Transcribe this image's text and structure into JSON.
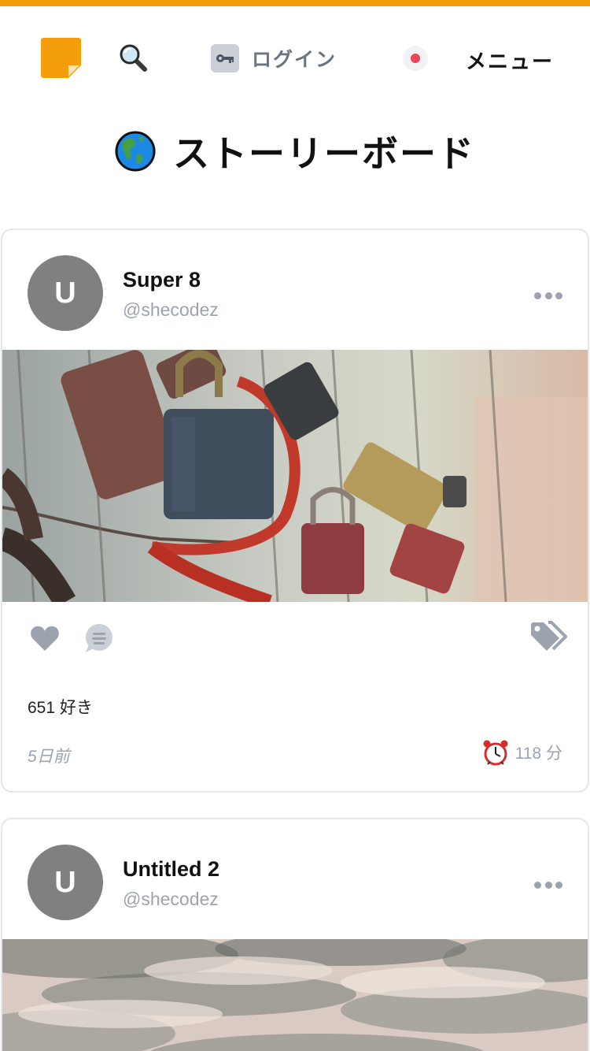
{
  "colors": {
    "accent": "#f59e0b",
    "status_dot": "#ef4458",
    "muted": "#9ca3af"
  },
  "nav": {
    "logo_icon": "sticky-note-icon",
    "search_icon": "magnifier-icon",
    "login_icon": "key-icon",
    "login_label": "ログイン",
    "status_icon": "red-dot-icon",
    "menu_label": "メニュー"
  },
  "page": {
    "title_icon": "globe-americas-icon",
    "title": "ストーリーボード"
  },
  "posts": [
    {
      "avatar_letter": "U",
      "title": "Super 8",
      "handle": "@shecodez",
      "image": "padlocks-on-fence-photo",
      "likes_text": "651 好き",
      "time_ago": "5日前",
      "duration": "118 分"
    },
    {
      "avatar_letter": "U",
      "title": "Untitled 2",
      "handle": "@shecodez",
      "image": "misty-forest-photo"
    }
  ]
}
